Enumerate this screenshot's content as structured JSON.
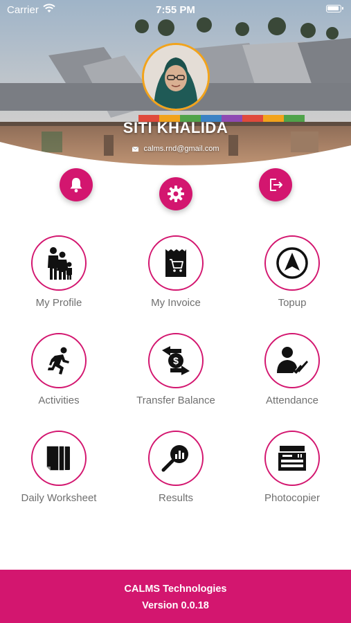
{
  "status_bar": {
    "carrier": "Carrier",
    "time": "7:55 PM"
  },
  "profile": {
    "name": "SITI KHALIDA",
    "email": "calms.rnd@gmail.com"
  },
  "menu": [
    {
      "label": "My Profile",
      "icon": "family-icon"
    },
    {
      "label": "My Invoice",
      "icon": "invoice-icon"
    },
    {
      "label": "Topup",
      "icon": "navigation-arrow-icon"
    },
    {
      "label": "Activities",
      "icon": "running-person-icon"
    },
    {
      "label": "Transfer Balance",
      "icon": "money-transfer-icon"
    },
    {
      "label": "Attendance",
      "icon": "attendance-icon"
    },
    {
      "label": "Daily Worksheet",
      "icon": "worksheet-icon"
    },
    {
      "label": "Results",
      "icon": "search-chart-icon"
    },
    {
      "label": "Photocopier",
      "icon": "photocopier-icon"
    }
  ],
  "footer": {
    "company": "CALMS Technologies",
    "version": "Version 0.0.18"
  },
  "colors": {
    "accent": "#d3166f",
    "avatar_ring": "#f2a31b",
    "label": "#6f6f6f"
  }
}
